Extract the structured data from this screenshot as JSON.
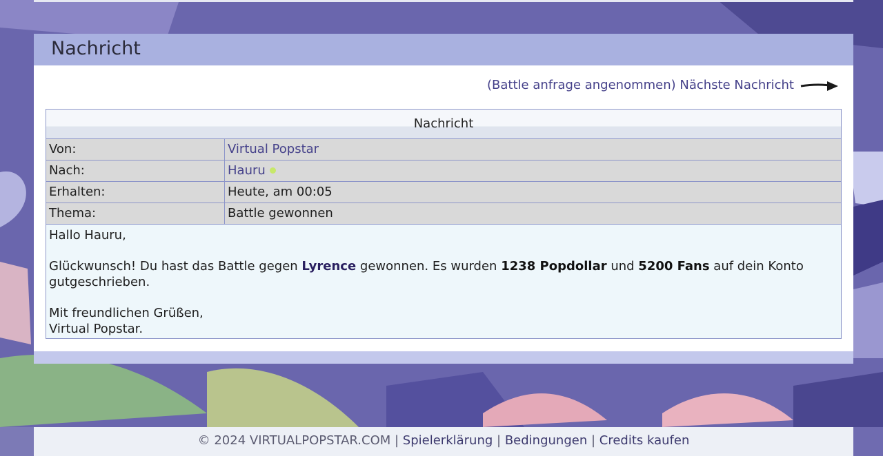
{
  "panel": {
    "title": "Nachricht",
    "next_link": "(Battle anfrage angenommen) Nächste Nachricht"
  },
  "message": {
    "table_header": "Nachricht",
    "rows": [
      {
        "label": "Von:",
        "value": "Virtual Popstar"
      },
      {
        "label": "Nach:",
        "value": "Hauru"
      },
      {
        "label": "Erhalten:",
        "value": "Heute, am 00:05"
      },
      {
        "label": "Thema:",
        "value": "Battle gewonnen"
      }
    ],
    "body": {
      "greeting": "Hallo Hauru,",
      "p1_a": "Glückwunsch! Du hast das Battle gegen ",
      "opponent": "Lyrence",
      "p1_b": " gewonnen. Es wurden ",
      "popdollar": "1238 Popdollar",
      "p1_c": " und ",
      "fans": "5200 Fans",
      "p1_d": " auf dein Konto gutgeschrieben.",
      "closing": "Mit freundlichen Grüßen,",
      "signature": "Virtual Popstar."
    }
  },
  "footer": {
    "copyright": "© 2024 VIRTUALPOPSTAR.COM",
    "sep": " | ",
    "links": [
      "Spielerklärung",
      "Bedingungen",
      "Credits kaufen"
    ]
  },
  "colors": {
    "header_bg": "#a9b1e0",
    "accent_link": "#45418a",
    "online": "#c7e86a"
  }
}
